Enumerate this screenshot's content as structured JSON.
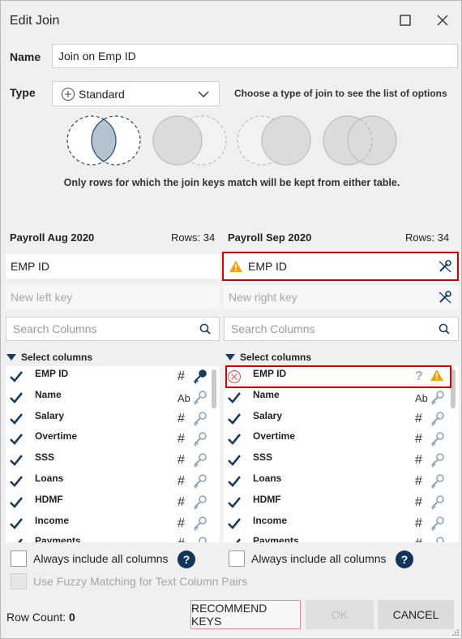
{
  "dialog": {
    "title": "Edit Join"
  },
  "name": {
    "label": "Name",
    "value": "Join on Emp ID"
  },
  "type": {
    "label": "Type",
    "selected": "Standard",
    "hint": "Choose a type of join to see the list of options",
    "description": "Only rows for which the join keys match will be kept from either table."
  },
  "left": {
    "table": "Payroll Aug 2020",
    "rows": "Rows: 34",
    "key": "EMP ID",
    "new_key_placeholder": "New left key",
    "search_placeholder": "Search Columns",
    "select_label": "Select columns",
    "columns": [
      {
        "name": "EMP ID",
        "type": "#"
      },
      {
        "name": "Name",
        "type": "Ab"
      },
      {
        "name": "Salary",
        "type": "#"
      },
      {
        "name": "Overtime",
        "type": "#"
      },
      {
        "name": "SSS",
        "type": "#"
      },
      {
        "name": "Loans",
        "type": "#"
      },
      {
        "name": "HDMF",
        "type": "#"
      },
      {
        "name": "Income",
        "type": "#"
      },
      {
        "name": "Payments",
        "type": "#"
      }
    ],
    "always_include": "Always include all columns"
  },
  "right": {
    "table": "Payroll Sep 2020",
    "rows": "Rows: 34",
    "key": "EMP ID",
    "new_key_placeholder": "New right key",
    "search_placeholder": "Search Columns",
    "select_label": "Select columns",
    "columns": [
      {
        "name": "EMP ID",
        "type": "?"
      },
      {
        "name": "Name",
        "type": "Ab"
      },
      {
        "name": "Salary",
        "type": "#"
      },
      {
        "name": "Overtime",
        "type": "#"
      },
      {
        "name": "SSS",
        "type": "#"
      },
      {
        "name": "Loans",
        "type": "#"
      },
      {
        "name": "HDMF",
        "type": "#"
      },
      {
        "name": "Income",
        "type": "#"
      },
      {
        "name": "Payments",
        "type": "#"
      }
    ],
    "always_include": "Always include all columns"
  },
  "fuzzy": "Use Fuzzy Matching for Text Column Pairs",
  "footer": {
    "row_count_label": "Row Count:",
    "row_count_value": "0",
    "recommend": "RECOMMEND KEYS",
    "ok": "OK",
    "cancel": "CANCEL"
  },
  "colors": {
    "accent": "#0f3f6e",
    "warning": "#f0a30a",
    "error": "#d40000"
  }
}
